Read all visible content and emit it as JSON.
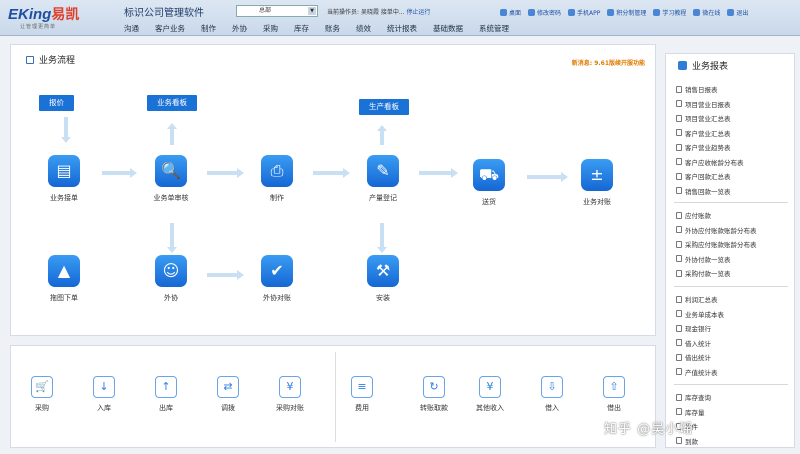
{
  "header": {
    "logo_main": "EKing",
    "logo_cn": "易凯",
    "logo_sub": "让管理更简单",
    "app_title": "标识公司管理软件",
    "dept_select": "总部",
    "operator_label": "当前操作员:",
    "operator_name": "吴晓霞 接单中...",
    "stop_runtime": "停止运行",
    "links": [
      {
        "label": "桌面",
        "icon": "desktop-icon"
      },
      {
        "label": "修改密码",
        "icon": "key-icon"
      },
      {
        "label": "手机APP",
        "icon": "phone-icon"
      },
      {
        "label": "积分制管理",
        "icon": "points-icon"
      },
      {
        "label": "学习教程",
        "icon": "book-icon"
      },
      {
        "label": "微在线",
        "icon": "chat-icon"
      },
      {
        "label": "退出",
        "icon": "exit-icon"
      }
    ]
  },
  "menu": [
    "沟通",
    "客户业务",
    "制作",
    "外协",
    "采购",
    "库存",
    "账务",
    "绩效",
    "统计报表",
    "基础数据",
    "系统管理"
  ],
  "flow": {
    "title": "业务流程",
    "notice": "新消息: 9.61版续开服功能",
    "tags": [
      "报价",
      "业务看板",
      "生产看板"
    ],
    "nodes": [
      {
        "id": "order",
        "label": "业务接单",
        "icon": "document-icon",
        "glyph": "▤"
      },
      {
        "id": "review",
        "label": "业务单审核",
        "icon": "review-search-icon",
        "glyph": "🔍"
      },
      {
        "id": "produce",
        "label": "制作",
        "icon": "printer-icon",
        "glyph": "⎙"
      },
      {
        "id": "output",
        "label": "产量登记",
        "icon": "edit-icon",
        "glyph": "✎"
      },
      {
        "id": "deliver",
        "label": "送货",
        "icon": "truck-icon",
        "glyph": "⛟"
      },
      {
        "id": "reconcile",
        "label": "业务对账",
        "icon": "calculator-icon",
        "glyph": "±"
      },
      {
        "id": "draw",
        "label": "拖图下单",
        "icon": "image-icon",
        "glyph": "▲"
      },
      {
        "id": "outsource",
        "label": "外协",
        "icon": "person-icon",
        "glyph": "☺"
      },
      {
        "id": "outsource_reconcile",
        "label": "外协对账",
        "icon": "person-check-icon",
        "glyph": "✔"
      },
      {
        "id": "install",
        "label": "安装",
        "icon": "drill-icon",
        "glyph": "⚒"
      }
    ]
  },
  "tools": [
    {
      "label": "采购",
      "icon": "cart-icon",
      "glyph": "🛒"
    },
    {
      "label": "入库",
      "icon": "inbound-icon",
      "glyph": "↓"
    },
    {
      "label": "出库",
      "icon": "outbound-icon",
      "glyph": "↑"
    },
    {
      "label": "调拨",
      "icon": "transfer-icon",
      "glyph": "⇄"
    },
    {
      "label": "采购对账",
      "icon": "purchase-reconcile-icon",
      "glyph": "¥"
    },
    {
      "label": "费用",
      "icon": "expense-icon",
      "glyph": "≡"
    },
    {
      "label": "转账取款",
      "icon": "transfer-cash-icon",
      "glyph": "↻"
    },
    {
      "label": "其他收入",
      "icon": "income-icon",
      "glyph": "¥"
    },
    {
      "label": "借入",
      "icon": "borrow-in-icon",
      "glyph": "⇩"
    },
    {
      "label": "借出",
      "icon": "borrow-out-icon",
      "glyph": "⇧"
    }
  ],
  "reports": {
    "title": "业务报表",
    "sections": [
      [
        "销售日报表",
        "项目营业日报表",
        "项目营业汇总表",
        "客户营业汇总表",
        "客户营业趋势表",
        "客户应收帐龄分布表",
        "客户回款汇总表",
        "销售回款一览表"
      ],
      [
        "应付账款",
        "外协应付账款账龄分布表",
        "采购应付账款账龄分布表",
        "外协付款一览表",
        "采购付款一览表"
      ],
      [
        "利润汇总表",
        "业务单成本表",
        "现金银行",
        "借入统计",
        "借出统计",
        "产值统计表"
      ],
      [
        "库存查询",
        "库存量",
        "发件",
        "到款"
      ]
    ]
  },
  "watermark": "知乎 @吴小瑶",
  "colors": {
    "accent": "#1a71d6",
    "notice": "#e07b00",
    "arrow": "#c8dff4"
  }
}
